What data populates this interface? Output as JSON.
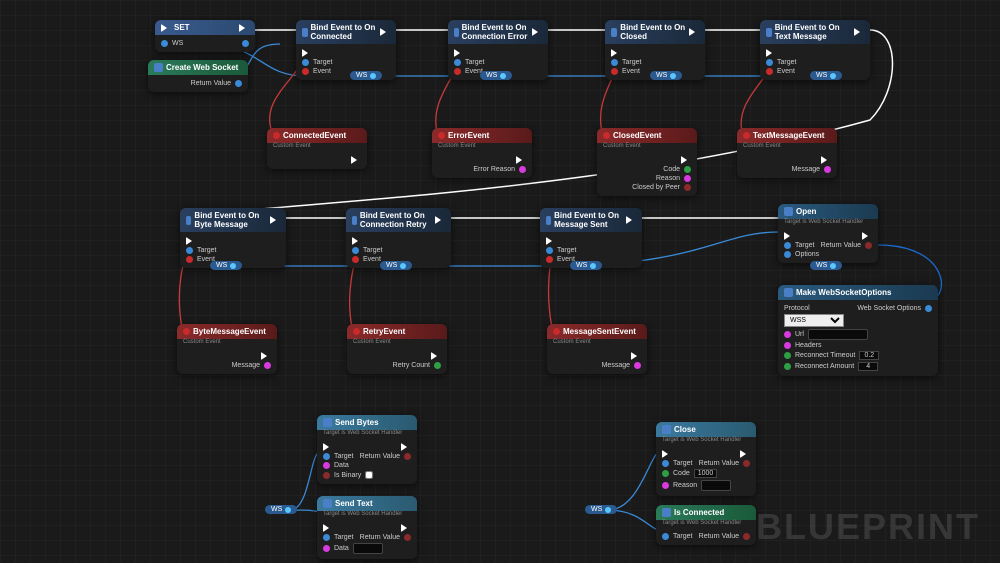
{
  "watermark": "BLUEPRINT",
  "ws_label": "WS",
  "nodes": {
    "set": {
      "title": "SET",
      "pins": {
        "ws": "WS"
      }
    },
    "createws": {
      "title": "Create Web Socket",
      "pins": {
        "retval": "Return Value"
      }
    },
    "bind_connected": {
      "title": "Bind Event to On Connected",
      "target": "Target",
      "event": "Event"
    },
    "bind_connerr": {
      "title": "Bind Event to On Connection Error",
      "target": "Target",
      "event": "Event"
    },
    "bind_closed": {
      "title": "Bind Event to On Closed",
      "target": "Target",
      "event": "Event"
    },
    "bind_textmsg": {
      "title": "Bind Event to On Text Message",
      "target": "Target",
      "event": "Event"
    },
    "bind_bytemsg": {
      "title": "Bind Event to On Byte Message",
      "target": "Target",
      "event": "Event"
    },
    "bind_connretry": {
      "title": "Bind Event to On Connection Retry",
      "target": "Target",
      "event": "Event"
    },
    "bind_msgsent": {
      "title": "Bind Event to On Message Sent",
      "target": "Target",
      "event": "Event"
    },
    "evt_connected": {
      "title": "ConnectedEvent",
      "sub": "Custom Event"
    },
    "evt_error": {
      "title": "ErrorEvent",
      "sub": "Custom Event",
      "pins": {
        "reason": "Error Reason"
      }
    },
    "evt_closed": {
      "title": "ClosedEvent",
      "sub": "Custom Event",
      "pins": {
        "code": "Code",
        "reason": "Reason",
        "cbp": "Closed by Peer"
      }
    },
    "evt_textmsg": {
      "title": "TextMessageEvent",
      "sub": "Custom Event",
      "pins": {
        "msg": "Message"
      }
    },
    "evt_bytemsg": {
      "title": "ByteMessageEvent",
      "sub": "Custom Event",
      "pins": {
        "msg": "Message"
      }
    },
    "evt_retry": {
      "title": "RetryEvent",
      "sub": "Custom Event",
      "pins": {
        "rc": "Retry Count"
      }
    },
    "evt_msgsent": {
      "title": "MessageSentEvent",
      "sub": "Custom Event",
      "pins": {
        "msg": "Message"
      }
    },
    "open": {
      "title": "Open",
      "sub": "Target is Web Socket Handler",
      "pins": {
        "target": "Target",
        "options": "Options",
        "retval": "Return Value"
      }
    },
    "makeopts": {
      "title": "Make WebSocketOptions",
      "pins": {
        "protocol": "Protocol",
        "protocol_val": "WSS",
        "url": "Url",
        "headers": "Headers",
        "rtimeout": "Reconnect Timeout",
        "rtimeout_val": "0.2",
        "ramount": "Reconnect Amount",
        "ramount_val": "4",
        "out": "Web Socket Options"
      }
    },
    "sendbytes": {
      "title": "Send Bytes",
      "sub": "Target is Web Socket Handler",
      "pins": {
        "target": "Target",
        "data": "Data",
        "isbin": "Is Binary",
        "retval": "Return Value"
      }
    },
    "sendtext": {
      "title": "Send Text",
      "sub": "Target is Web Socket Handler",
      "pins": {
        "target": "Target",
        "data": "Data",
        "retval": "Return Value"
      }
    },
    "close": {
      "title": "Close",
      "sub": "Target is Web Socket Handler",
      "pins": {
        "target": "Target",
        "code": "Code",
        "code_val": "1000",
        "reason": "Reason",
        "retval": "Return Value"
      }
    },
    "isconn": {
      "title": "Is Connected",
      "sub": "Target is Web Socket Handler",
      "pins": {
        "target": "Target",
        "retval": "Return Value"
      }
    }
  }
}
